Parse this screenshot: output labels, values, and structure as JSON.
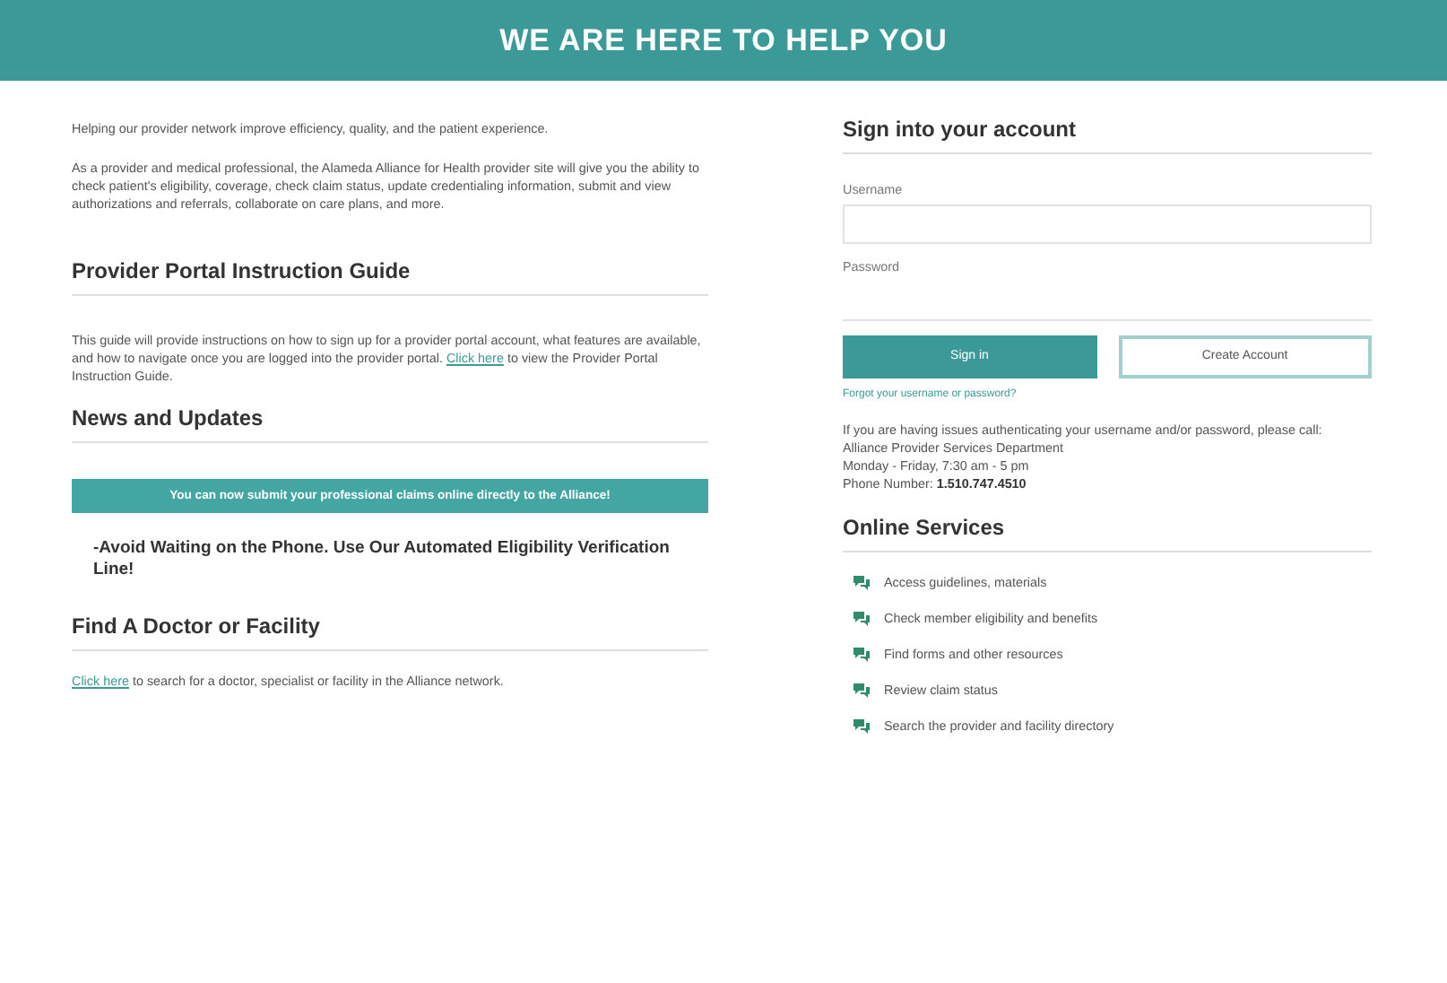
{
  "header": {
    "title": "WE ARE HERE TO HELP YOU"
  },
  "intro": [
    "Helping our provider network improve efficiency, quality, and the patient experience.",
    "As a provider and medical professional, the Alameda Alliance for Health provider site will give you the ability to check patient's eligibility, coverage, check claim status, update credentialing information, submit and view authorizations and referrals, collaborate on care plans, and more."
  ],
  "guide": {
    "heading": "Provider Portal Instruction Guide",
    "text_before": "This guide will provide instructions on how to sign up for a provider portal account, what features are available, and how to navigate once you are logged into the provider portal.",
    "link": "Click here",
    "text_after": "to view the Provider Portal Instruction Guide."
  },
  "news": {
    "heading": "News and Updates",
    "banner": "You can now submit your professional claims online directly to the Alliance!",
    "notice": "-Avoid Waiting on the Phone. Use Our Automated Eligibility Verification Line!"
  },
  "find": {
    "heading": "Find A Doctor or Facility",
    "link": "Click here",
    "text_after": "to search for a doctor, specialist or facility in the Alliance network."
  },
  "signin": {
    "heading": "Sign into your account",
    "username_label": "Username",
    "password_label": "Password",
    "sign_in": "Sign in",
    "create": "Create Account",
    "forgot": "Forgot your username or password?",
    "help_lines": [
      "If you are having issues authenticating your username and/or password, please call:",
      "Alliance Provider Services Department",
      "Monday - Friday, 7:30 am - 5 pm"
    ],
    "phone_label": "Phone Number:",
    "phone": "1.510.747.4510"
  },
  "services": {
    "heading": "Online Services",
    "items": [
      "Access guidelines, materials",
      "Check member eligibility and benefits",
      "Find forms and other resources",
      "Review claim status",
      "Search the provider and facility directory"
    ]
  }
}
